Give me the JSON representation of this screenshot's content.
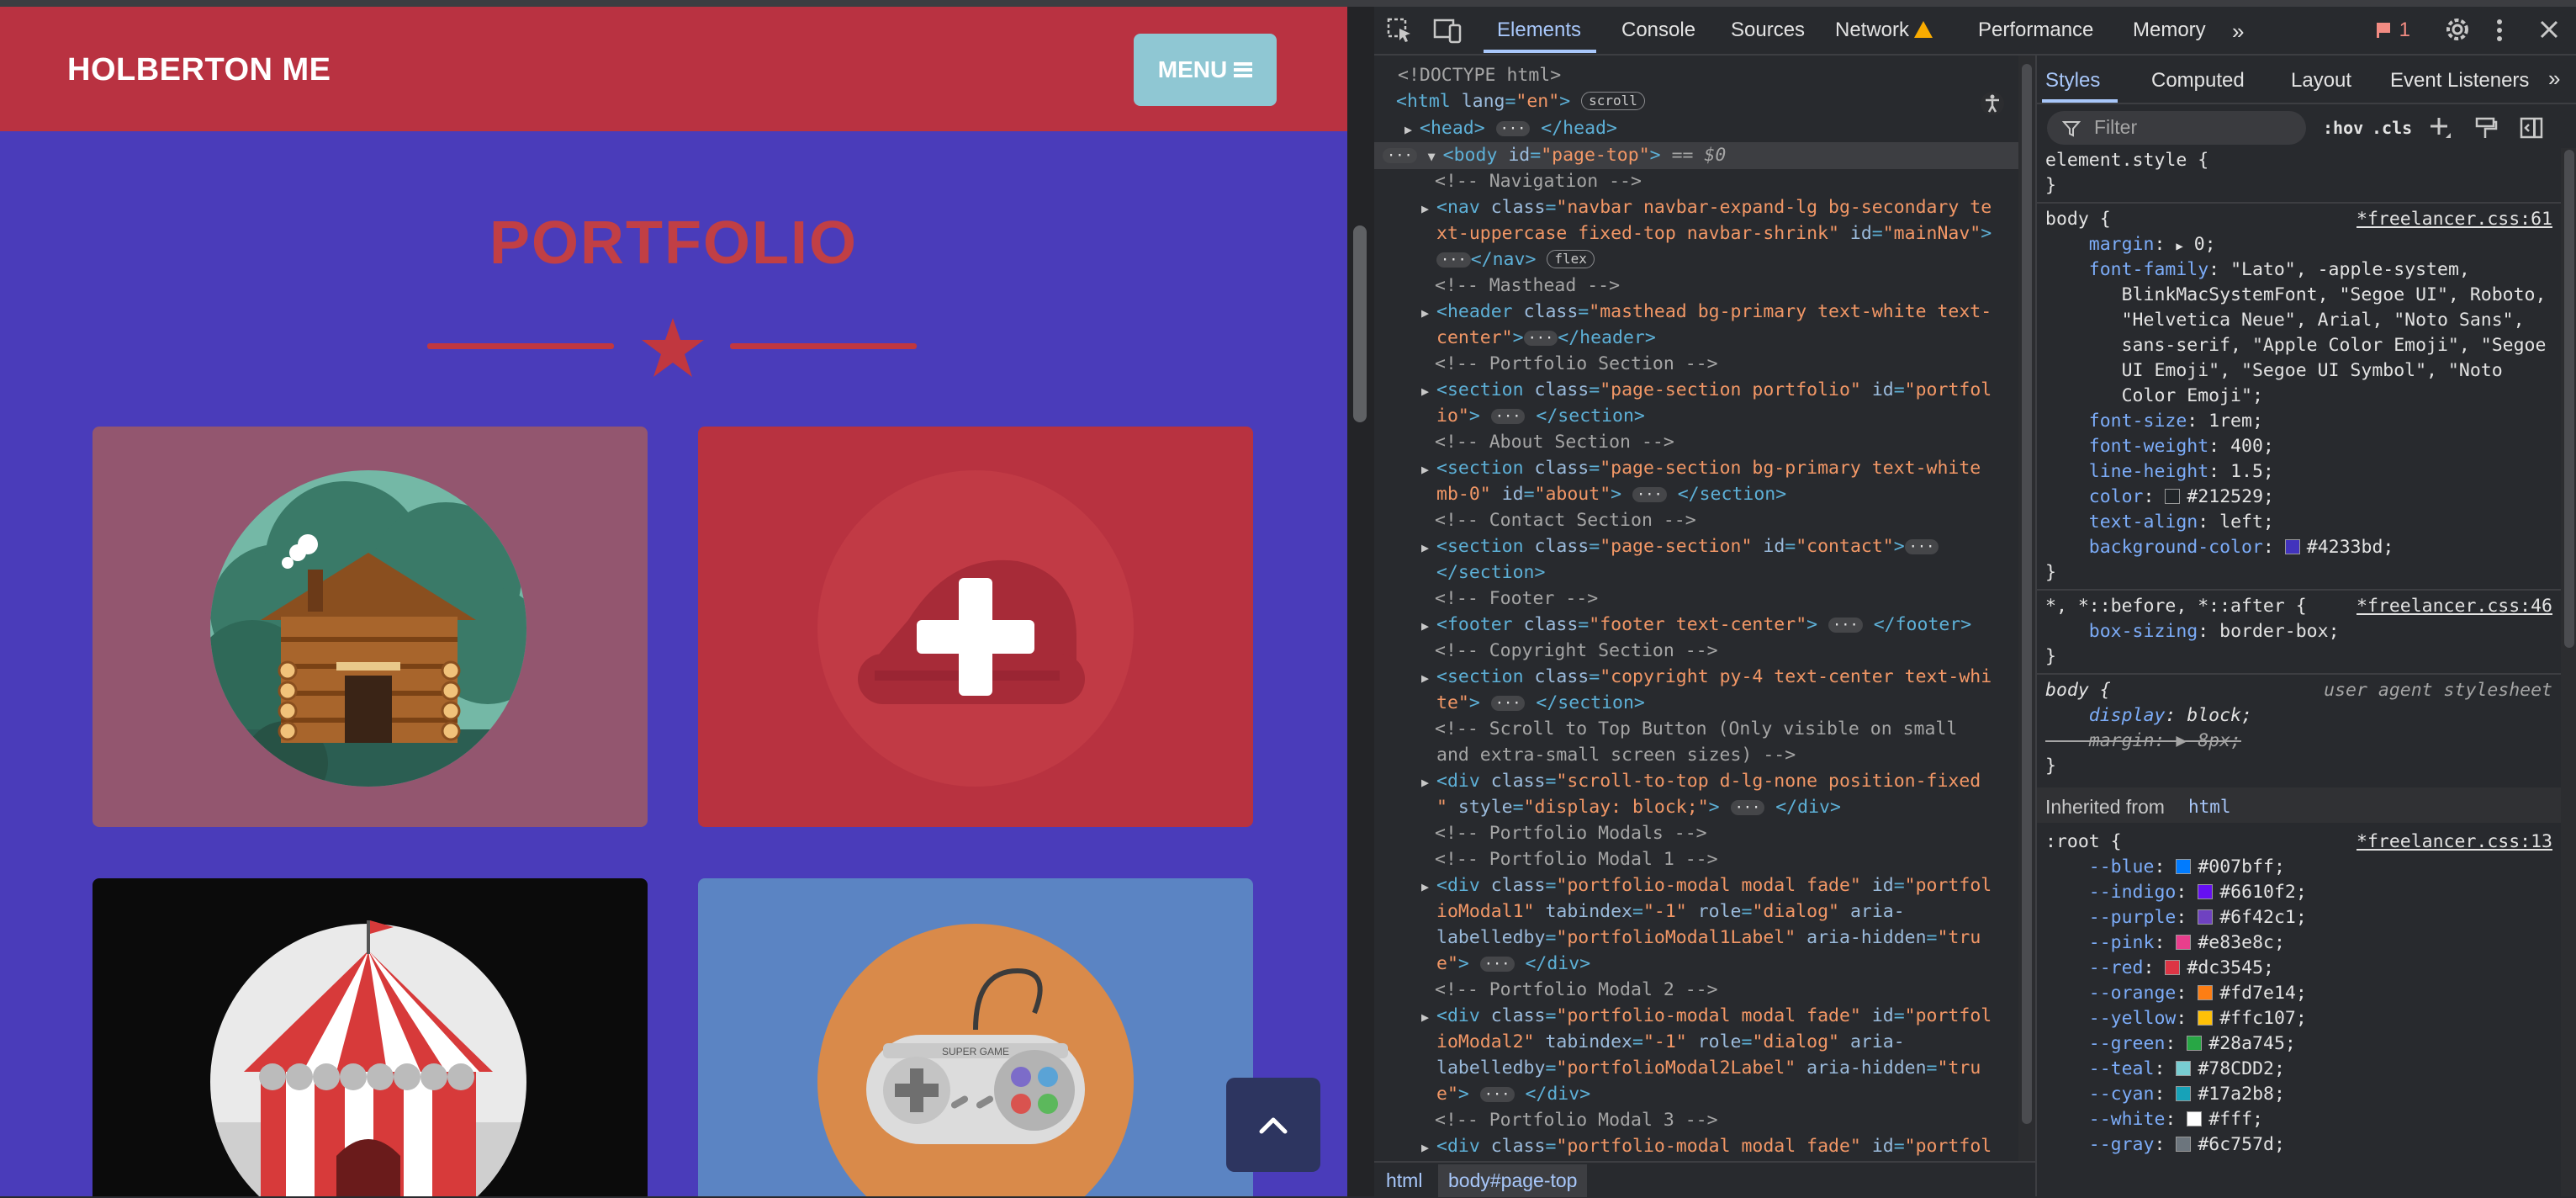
{
  "website": {
    "brand": "HOLBERTON ME",
    "menu_label": "MENU",
    "section_title": "PORTFOLIO",
    "colors": {
      "navbar": "#b93241",
      "page_bg": "#4a3cba",
      "menu_button": "#8fc7d3",
      "title": "#c13f45"
    },
    "cards": [
      {
        "name": "cabin",
        "bg": "#93566f"
      },
      {
        "name": "cake",
        "bg": "#b83240",
        "hovered": true
      },
      {
        "name": "circus-tent",
        "bg": "#0b0b0b"
      },
      {
        "name": "game-controller",
        "bg": "#5b84c3"
      }
    ],
    "controller_text": "SUPER GAME"
  },
  "devtools": {
    "tabs": [
      "Elements",
      "Console",
      "Sources",
      "Network",
      "Performance",
      "Memory"
    ],
    "active_tab": "Elements",
    "issues_count": "1",
    "elements": {
      "doctype": "<!DOCTYPE html>",
      "breadcrumb": [
        "html",
        "body#page-top"
      ]
    },
    "styles": {
      "subtabs": [
        "Styles",
        "Computed",
        "Layout",
        "Event Listeners"
      ],
      "active_subtab": "Styles",
      "filter_placeholder": "Filter",
      "hov": ":hov",
      "cls": ".cls",
      "inherited_from": "Inherited from",
      "inherited_tag": "html",
      "body_rule_source": "*freelancer.css:61",
      "universal_rule_source": "*freelancer.css:46",
      "root_rule_source": "*freelancer.css:13",
      "user_agent_label": "user agent stylesheet",
      "root_vars": [
        {
          "name": "--blue",
          "value": "#007bff"
        },
        {
          "name": "--indigo",
          "value": "#6610f2"
        },
        {
          "name": "--purple",
          "value": "#6f42c1"
        },
        {
          "name": "--pink",
          "value": "#e83e8c"
        },
        {
          "name": "--red",
          "value": "#dc3545"
        },
        {
          "name": "--orange",
          "value": "#fd7e14"
        },
        {
          "name": "--yellow",
          "value": "#ffc107"
        },
        {
          "name": "--green",
          "value": "#28a745"
        },
        {
          "name": "--teal",
          "value": "#78CDD2"
        },
        {
          "name": "--cyan",
          "value": "#17a2b8"
        },
        {
          "name": "--white",
          "value": "#fff"
        },
        {
          "name": "--gray",
          "value": "#6c757d"
        }
      ]
    }
  }
}
